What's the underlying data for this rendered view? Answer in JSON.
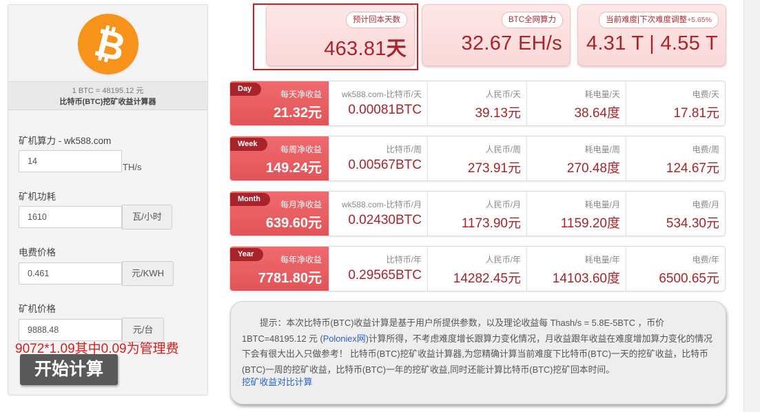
{
  "calculator": {
    "coin_icon": "bitcoin-logo-icon",
    "btc_price_line": "1 BTC = 48195.12 元",
    "title": "比特币(BTC)挖矿收益计算器",
    "fields": {
      "hashrate": {
        "label": "矿机算力 - wk588.com",
        "value": "14",
        "unit": "TH/s"
      },
      "power": {
        "label": "矿机功耗",
        "value": "1610",
        "unit": "瓦/小时"
      },
      "electricity": {
        "label": "电费价格",
        "value": "0.461",
        "unit": "元/KWH"
      },
      "miner_price": {
        "label": "矿机价格",
        "value": "9888.48",
        "unit": "元/台"
      }
    },
    "note": "9072*1.09其中0.09为管理费",
    "start_button": "开始计算"
  },
  "stats": {
    "payback": {
      "label": "预计回本天数",
      "value": "463.81",
      "unit": "天"
    },
    "network": {
      "label": "BTC全网算力",
      "value": "32.67 EH/s"
    },
    "difficulty": {
      "label": "当前难度|下次难度调整",
      "change": "+5.65%",
      "value": "4.31 T | 4.55 T"
    }
  },
  "rows": [
    {
      "tag": "Day",
      "net_label": "每天净收益",
      "net_value": "21.32元",
      "btc_label": "wk588.com-比特币/天",
      "btc_value": "0.00081BTC",
      "rmb_label": "人民币/天",
      "rmb_value": "39.13元",
      "power_label": "耗电量/天",
      "power_value": "38.64度",
      "cost_label": "电费/天",
      "cost_value": "17.81元"
    },
    {
      "tag": "Week",
      "net_label": "每周净收益",
      "net_value": "149.24元",
      "btc_label": "比特币/周",
      "btc_value": "0.00567BTC",
      "rmb_label": "人民币/周",
      "rmb_value": "273.91元",
      "power_label": "耗电量/周",
      "power_value": "270.48度",
      "cost_label": "电费/周",
      "cost_value": "124.67元"
    },
    {
      "tag": "Month",
      "net_label": "每月净收益",
      "net_value": "639.60元",
      "btc_label": "wk588.com-比特币/月",
      "btc_value": "0.02430BTC",
      "rmb_label": "人民币/月",
      "rmb_value": "1173.90元",
      "power_label": "耗电量/月",
      "power_value": "1159.20度",
      "cost_label": "电费/月",
      "cost_value": "534.30元"
    },
    {
      "tag": "Year",
      "net_label": "每年净收益",
      "net_value": "7781.80元",
      "btc_label": "比特币/年",
      "btc_value": "0.29565BTC",
      "rmb_label": "人民币/年",
      "rmb_value": "14282.45元",
      "power_label": "耗电量/年",
      "power_value": "14103.60度",
      "cost_label": "电费/年",
      "cost_value": "6500.65元"
    }
  ],
  "tip": {
    "text_before_link": "提示：本次比特币(BTC)收益计算是基于用户所提供参数，以及理论收益每 Thash/s = 5.8E-5BTC ，币价 1BTC=48195.12 元 (",
    "link": "Poloniex网",
    "text_after_link": ")计算所得，不考虑难度增长跟算力变化情况，月收益跟年收益在难度增加算力变化的情况下会有很大出入只做参考！ 比特币(BTC)挖矿收益计算器,为您精确计算当前难度下比特币(BTC)一天的挖矿收益，比特币(BTC)一周的挖矿收益，比特币(BTC)一年的挖矿收益,同时还能计算比特币(BTC)挖矿回本时间。",
    "bottom_link": "挖矿收益对比计算"
  },
  "colors": {
    "accent_red": "#e35357",
    "dark_red": "#a9232b",
    "bitcoin_orange": "#f7931a",
    "link_blue": "#2b63c6"
  }
}
